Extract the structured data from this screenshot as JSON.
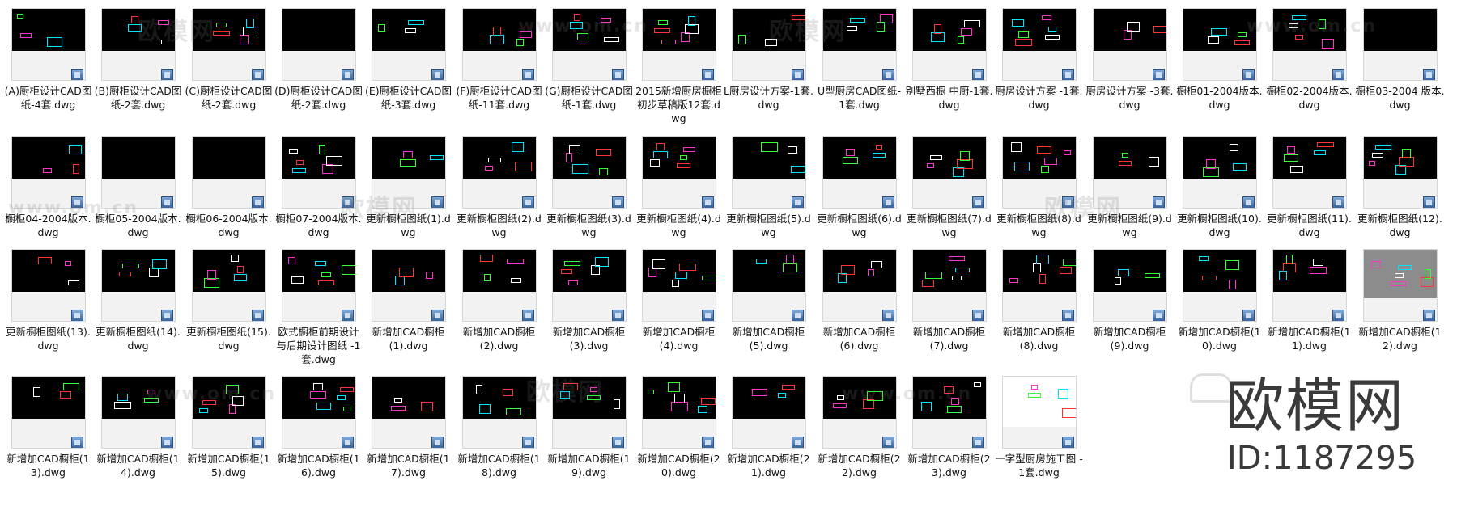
{
  "files": [
    "(A)厨柜设计CAD图纸-4套.dwg",
    "(B)厨柜设计CAD图纸-2套.dwg",
    "(C)厨柜设计CAD图纸-2套.dwg",
    "(D)厨柜设计CAD图纸-2套.dwg",
    "(E)厨柜设计CAD图纸-3套.dwg",
    "(F)厨柜设计CAD图纸-11套.dwg",
    "(G)厨柜设计CAD图纸-1套.dwg",
    "2015新增厨房橱柜初步草稿版12套.dwg",
    "L厨房设计方案-1套.dwg",
    "U型厨房CAD图纸-1套.dwg",
    "别墅西橱 中厨-1套.dwg",
    "厨房设计方案 -1套.dwg",
    "厨房设计方案 -3套.dwg",
    "橱柜01-2004版本.dwg",
    "橱柜02-2004版本.dwg",
    "橱柜03-2004 版本.dwg",
    "橱柜04-2004版本.dwg",
    "橱柜05-2004版本.dwg",
    "橱柜06-2004版本.dwg",
    "橱柜07-2004版本.dwg",
    "更新橱柜图纸(1).dwg",
    "更新橱柜图纸(2).dwg",
    "更新橱柜图纸(3).dwg",
    "更新橱柜图纸(4).dwg",
    "更新橱柜图纸(5).dwg",
    "更新橱柜图纸(6).dwg",
    "更新橱柜图纸(7).dwg",
    "更新橱柜图纸(8).dwg",
    "更新橱柜图纸(9).dwg",
    "更新橱柜图纸(10).dwg",
    "更新橱柜图纸(11).dwg",
    "更新橱柜图纸(12).dwg",
    "更新橱柜图纸(13).dwg",
    "更新橱柜图纸(14).dwg",
    "更新橱柜图纸(15).dwg",
    "欧式橱柜前期设计与后期设计图纸 -1套.dwg",
    "新增加CAD橱柜(1).dwg",
    "新增加CAD橱柜(2).dwg",
    "新增加CAD橱柜(3).dwg",
    "新增加CAD橱柜(4).dwg",
    "新增加CAD橱柜(5).dwg",
    "新增加CAD橱柜(6).dwg",
    "新增加CAD橱柜(7).dwg",
    "新增加CAD橱柜(8).dwg",
    "新增加CAD橱柜(9).dwg",
    "新增加CAD橱柜(10).dwg",
    "新增加CAD橱柜(11).dwg",
    "新增加CAD橱柜(12).dwg",
    "新增加CAD橱柜(13).dwg",
    "新增加CAD橱柜(14).dwg",
    "新增加CAD橱柜(15).dwg",
    "新增加CAD橱柜(16).dwg",
    "新增加CAD橱柜(17).dwg",
    "新增加CAD橱柜(18).dwg",
    "新增加CAD橱柜(19).dwg",
    "新增加CAD橱柜(20).dwg",
    "新增加CAD橱柜(21).dwg",
    "新增加CAD橱柜(22).dwg",
    "新增加CAD橱柜(23).dwg",
    "一字型厨房施工图 -1套.dwg"
  ],
  "watermark": {
    "text": "欧模网",
    "url": "www.om.cn"
  },
  "brand": {
    "title": "欧模网",
    "id": "ID:1187295"
  },
  "icons": {
    "file": "dwg-file-icon"
  },
  "colors": {
    "background": "#ffffff",
    "thumb_bg": "#000000",
    "cad_green": "#33ff33",
    "cad_cyan": "#00e5ff",
    "cad_magenta": "#ff33cc",
    "cad_red": "#ff3333",
    "cad_white": "#ffffff"
  }
}
